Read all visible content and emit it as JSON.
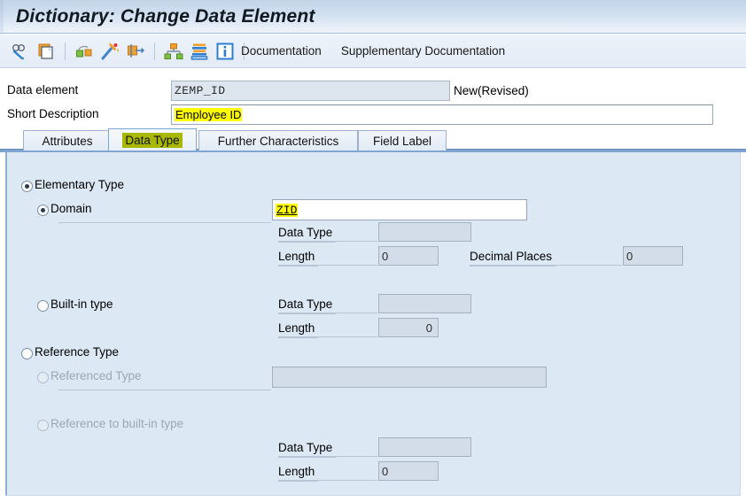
{
  "window": {
    "title": "Dictionary: Change Data Element"
  },
  "toolbar": {
    "icons": [
      {
        "name": "display-change-icon",
        "glyph": "display-change"
      },
      {
        "name": "copy-icon",
        "glyph": "copy"
      },
      {
        "name": "other-object-icon",
        "glyph": "other-object"
      },
      {
        "name": "generate-icon",
        "glyph": "magic-wand"
      },
      {
        "name": "replace-icon",
        "glyph": "replace"
      },
      {
        "name": "hierarchy-icon",
        "glyph": "hierarchy"
      },
      {
        "name": "where-used-list-icon",
        "glyph": "where-used"
      },
      {
        "name": "information-icon",
        "glyph": "info"
      }
    ],
    "documentation_label": "Documentation",
    "supplementary_documentation_label": "Supplementary Documentation"
  },
  "header": {
    "data_element_label": "Data element",
    "data_element_value": "ZEMP_ID",
    "status": "New(Revised)",
    "short_description_label": "Short Description",
    "short_description_value": "Employee ID"
  },
  "tabs": [
    {
      "label": "Attributes",
      "active": false
    },
    {
      "label": "Data Type",
      "active": true
    },
    {
      "label": "Further Characteristics",
      "active": false
    },
    {
      "label": "Field Label",
      "active": false
    }
  ],
  "data_type": {
    "elementary_type_label": "Elementary Type",
    "domain_label": "Domain",
    "domain_value": "ZID",
    "domain_data_type_label": "Data Type",
    "domain_data_type_value": "",
    "domain_length_label": "Length",
    "domain_length_value": "0",
    "decimal_places_label": "Decimal Places",
    "decimal_places_value": "0",
    "builtin_type_label": "Built-in type",
    "builtin_data_type_label": "Data Type",
    "builtin_data_type_value": "",
    "builtin_length_label": "Length",
    "builtin_length_value": "0",
    "reference_type_label": "Reference Type",
    "referenced_type_label": "Referenced Type",
    "referenced_type_value": "",
    "reference_builtin_label": "Reference to built-in type",
    "ref_builtin_data_type_label": "Data Type",
    "ref_builtin_data_type_value": "",
    "ref_builtin_length_label": "Length",
    "ref_builtin_length_value": "0"
  },
  "colors": {
    "highlight_yellow": "#ffff00",
    "active_tab_highlight": "#a8b800",
    "panel_background": "#dce8f3",
    "titlebar_top": "#c3d4e8"
  }
}
